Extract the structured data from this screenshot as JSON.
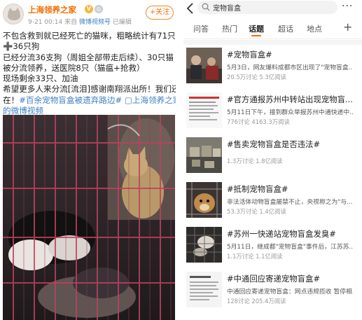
{
  "post": {
    "author": "上海领养之家",
    "badge_v": "V",
    "badge_medal": "◎",
    "time": "9-21 00:14",
    "source_prefix": "来自",
    "source": "微博视频号",
    "edited": "已编辑",
    "follow_label": "+关注",
    "text_lines": [
      "不包含救到就已经死亡的猫咪，粗略统计有71只猫",
      "➕36只狗",
      "已经分流36支狗（周姐全部带走后续）、30只猫",
      "被分流领养，送医院8只（猫瘟+抢救）",
      "现场剩余33只、加油",
      "希望更多人来分流[流泪]感谢南翔派出所！我们还"
    ],
    "text_last_prefix": "在！",
    "hashtag": "#百余宠物盲盒被遗弃路边#",
    "video_link": " ▢上海领养之家",
    "video_link_line2": "的微博视频"
  },
  "search": {
    "query": "宠物盲盒",
    "more": "···"
  },
  "tabs": [
    {
      "label": "问答"
    },
    {
      "label": "热门"
    },
    {
      "label": "话题"
    },
    {
      "label": "超话"
    },
    {
      "label": "地点"
    }
  ],
  "tab_plus": "+",
  "accent_color": "#f26d00",
  "link_color": "#3f7fc4",
  "topics": [
    {
      "title": "#宠物盲盒#",
      "desc": "5月3日，网友爆料成都市区出现了\"宠物盲盒...",
      "stats": "20.5万讨论 5.3亿阅读",
      "thumb": "thumb-people"
    },
    {
      "title": "#官方通报苏州中转站出现宠物盲...",
      "desc": "5月11日下午，接到群众举报苏州中通快递中...",
      "stats": "776讨论 4163.3万阅读",
      "thumb": "thumb-document"
    },
    {
      "title": "#售卖宠物盲盒是否违法#",
      "desc": "",
      "stats": "1.3万讨论 1.8亿阅读",
      "thumb": "thumb-cages"
    },
    {
      "title": "#抵制宠物盲盒#",
      "desc": "非法活体动物盲盒屡禁不止，央视称之为\"与...",
      "stats": "53.3万讨论 1.4亿阅读",
      "thumb": "thumb-dog"
    },
    {
      "title": "#苏州一快递站宠物盲盒发臭#",
      "desc": "5月11日，继成都\"宠物盲盒\"事件后，江苏苏...",
      "stats": "1.1万讨论 1.1亿阅读",
      "thumb": "thumb-crate"
    },
    {
      "title": "#中通回应寄递宠物盲盒#",
      "desc": "中通回应寄递宠物盲盒：网点违规揽收 暂停相...",
      "stats": "128讨论 205.4万阅读",
      "thumb": "thumb-notice"
    }
  ]
}
